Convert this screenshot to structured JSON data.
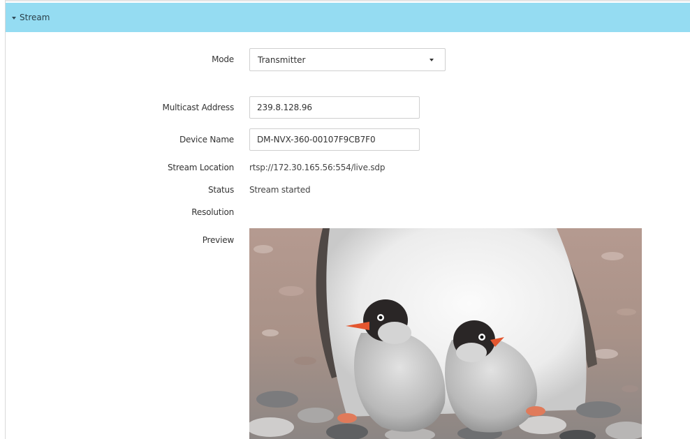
{
  "panel": {
    "title": "Stream"
  },
  "fields": {
    "mode": {
      "label": "Mode",
      "value": "Transmitter"
    },
    "multicast_address": {
      "label": "Multicast Address",
      "value": "239.8.128.96"
    },
    "device_name": {
      "label": "Device Name",
      "value": "DM-NVX-360-00107F9CB7F0"
    },
    "stream_location": {
      "label": "Stream Location",
      "value": "rtsp://172.30.165.56:554/live.sdp"
    },
    "status": {
      "label": "Status",
      "value": "Stream started"
    },
    "resolution": {
      "label": "Resolution",
      "value": ""
    },
    "preview": {
      "label": "Preview"
    }
  },
  "colors": {
    "header_bg": "#95dcf2",
    "border": "#cfcfcf"
  },
  "icons": {
    "header_toggle": "caret-down-icon",
    "select_toggle": "dropdown-arrow-icon"
  }
}
